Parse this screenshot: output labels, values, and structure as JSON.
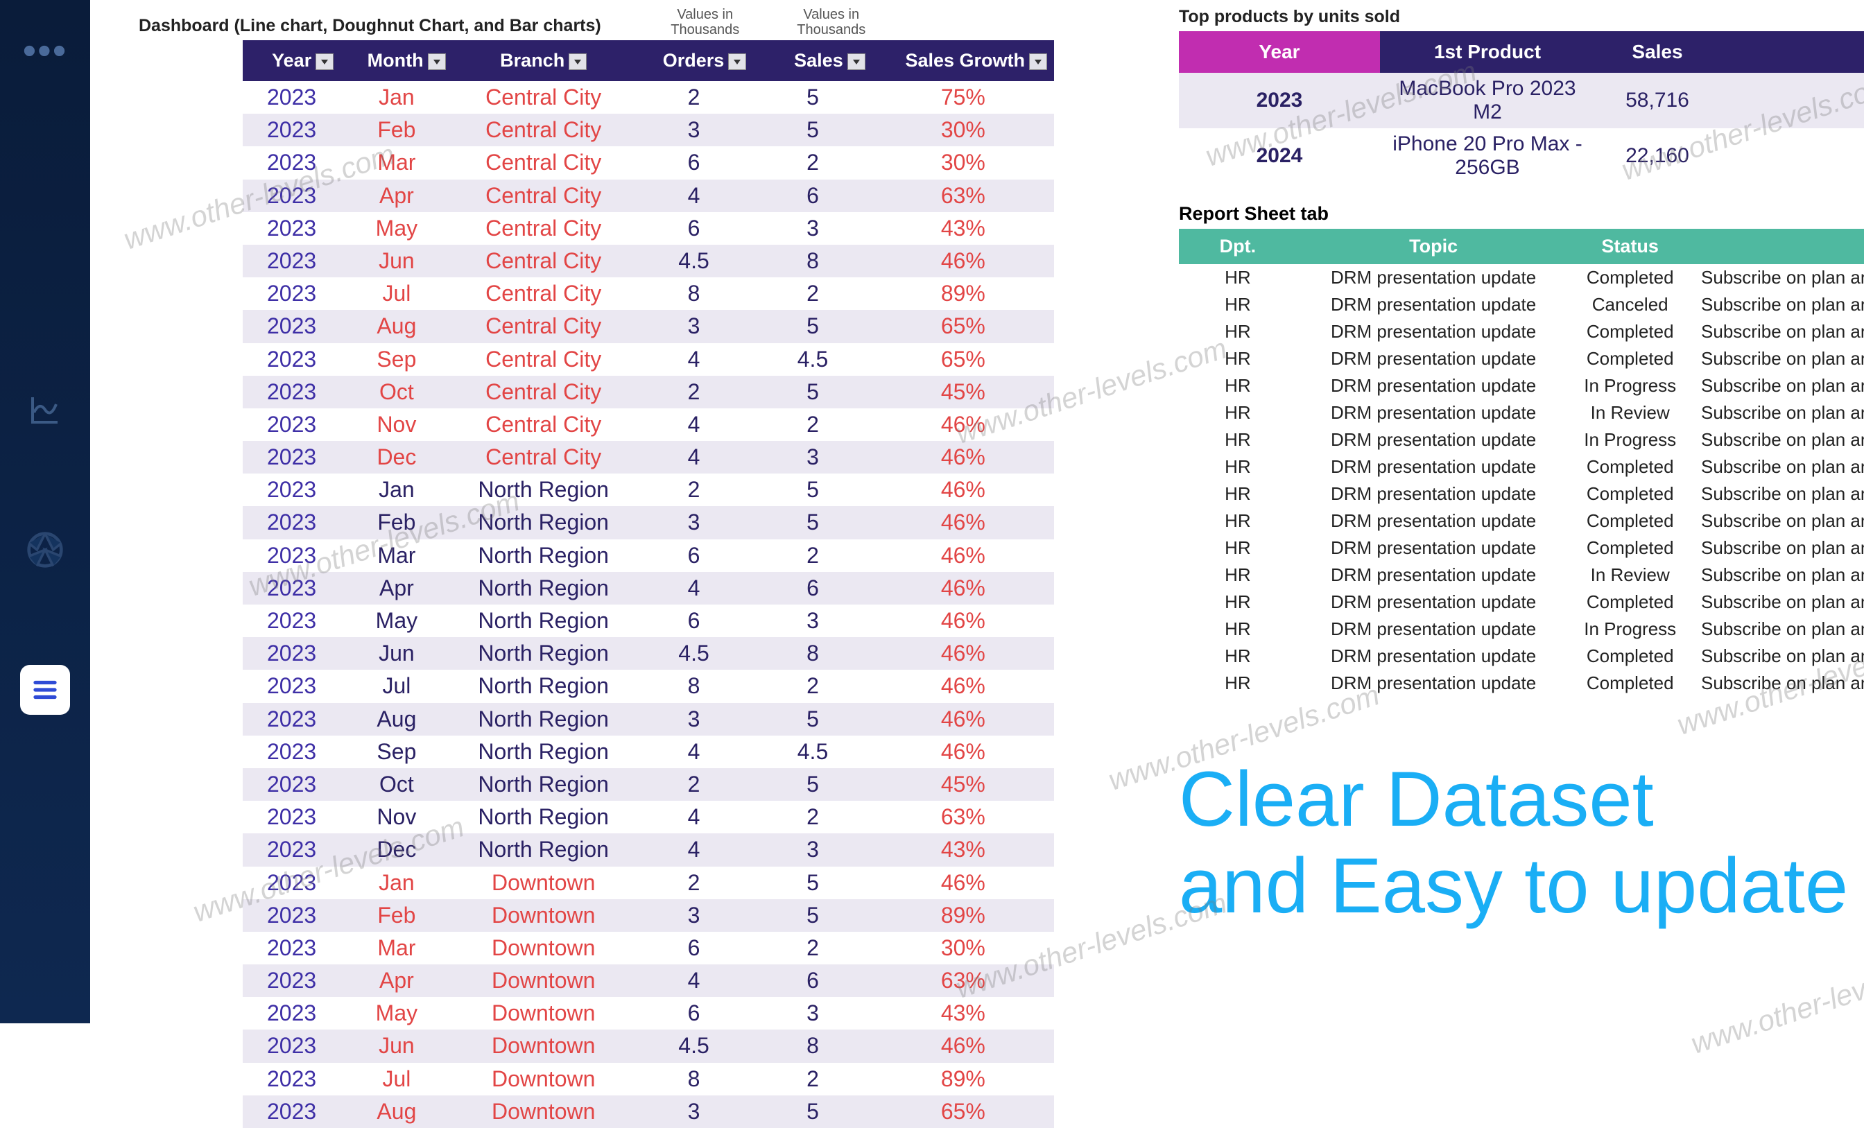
{
  "sidebar": {
    "dots": "•••"
  },
  "dashboard": {
    "title": "Dashboard (Line chart, Doughnut Chart, and Bar charts)",
    "header_note1": "Values in Thousands",
    "header_note2": "Values in Thousands",
    "columns": [
      "Year",
      "Month",
      "Branch",
      "Orders",
      "Sales",
      "Sales Growth"
    ],
    "rows": [
      {
        "year": "2023",
        "month": "Jan",
        "branch": "Central City",
        "orders": "2",
        "sales": "5",
        "growth": "75%",
        "cls": "cc"
      },
      {
        "year": "2023",
        "month": "Feb",
        "branch": "Central City",
        "orders": "3",
        "sales": "5",
        "growth": "30%",
        "cls": "cc"
      },
      {
        "year": "2023",
        "month": "Mar",
        "branch": "Central City",
        "orders": "6",
        "sales": "2",
        "growth": "30%",
        "cls": "cc"
      },
      {
        "year": "2023",
        "month": "Apr",
        "branch": "Central City",
        "orders": "4",
        "sales": "6",
        "growth": "63%",
        "cls": "cc"
      },
      {
        "year": "2023",
        "month": "May",
        "branch": "Central City",
        "orders": "6",
        "sales": "3",
        "growth": "43%",
        "cls": "cc"
      },
      {
        "year": "2023",
        "month": "Jun",
        "branch": "Central City",
        "orders": "4.5",
        "sales": "8",
        "growth": "46%",
        "cls": "cc"
      },
      {
        "year": "2023",
        "month": "Jul",
        "branch": "Central City",
        "orders": "8",
        "sales": "2",
        "growth": "89%",
        "cls": "cc"
      },
      {
        "year": "2023",
        "month": "Aug",
        "branch": "Central City",
        "orders": "3",
        "sales": "5",
        "growth": "65%",
        "cls": "cc"
      },
      {
        "year": "2023",
        "month": "Sep",
        "branch": "Central City",
        "orders": "4",
        "sales": "4.5",
        "growth": "65%",
        "cls": "cc"
      },
      {
        "year": "2023",
        "month": "Oct",
        "branch": "Central City",
        "orders": "2",
        "sales": "5",
        "growth": "45%",
        "cls": "cc"
      },
      {
        "year": "2023",
        "month": "Nov",
        "branch": "Central City",
        "orders": "4",
        "sales": "2",
        "growth": "46%",
        "cls": "cc"
      },
      {
        "year": "2023",
        "month": "Dec",
        "branch": "Central City",
        "orders": "4",
        "sales": "3",
        "growth": "46%",
        "cls": "cc"
      },
      {
        "year": "2023",
        "month": "Jan",
        "branch": "North Region",
        "orders": "2",
        "sales": "5",
        "growth": "46%",
        "cls": "nr"
      },
      {
        "year": "2023",
        "month": "Feb",
        "branch": "North Region",
        "orders": "3",
        "sales": "5",
        "growth": "46%",
        "cls": "nr"
      },
      {
        "year": "2023",
        "month": "Mar",
        "branch": "North Region",
        "orders": "6",
        "sales": "2",
        "growth": "46%",
        "cls": "nr"
      },
      {
        "year": "2023",
        "month": "Apr",
        "branch": "North Region",
        "orders": "4",
        "sales": "6",
        "growth": "46%",
        "cls": "nr"
      },
      {
        "year": "2023",
        "month": "May",
        "branch": "North Region",
        "orders": "6",
        "sales": "3",
        "growth": "46%",
        "cls": "nr"
      },
      {
        "year": "2023",
        "month": "Jun",
        "branch": "North Region",
        "orders": "4.5",
        "sales": "8",
        "growth": "46%",
        "cls": "nr"
      },
      {
        "year": "2023",
        "month": "Jul",
        "branch": "North Region",
        "orders": "8",
        "sales": "2",
        "growth": "46%",
        "cls": "nr"
      },
      {
        "year": "2023",
        "month": "Aug",
        "branch": "North Region",
        "orders": "3",
        "sales": "5",
        "growth": "46%",
        "cls": "nr"
      },
      {
        "year": "2023",
        "month": "Sep",
        "branch": "North Region",
        "orders": "4",
        "sales": "4.5",
        "growth": "46%",
        "cls": "nr"
      },
      {
        "year": "2023",
        "month": "Oct",
        "branch": "North Region",
        "orders": "2",
        "sales": "5",
        "growth": "45%",
        "cls": "nr"
      },
      {
        "year": "2023",
        "month": "Nov",
        "branch": "North Region",
        "orders": "4",
        "sales": "2",
        "growth": "63%",
        "cls": "nr"
      },
      {
        "year": "2023",
        "month": "Dec",
        "branch": "North Region",
        "orders": "4",
        "sales": "3",
        "growth": "43%",
        "cls": "nr"
      },
      {
        "year": "2023",
        "month": "Jan",
        "branch": "Downtown",
        "orders": "2",
        "sales": "5",
        "growth": "46%",
        "cls": "dt"
      },
      {
        "year": "2023",
        "month": "Feb",
        "branch": "Downtown",
        "orders": "3",
        "sales": "5",
        "growth": "89%",
        "cls": "dt"
      },
      {
        "year": "2023",
        "month": "Mar",
        "branch": "Downtown",
        "orders": "6",
        "sales": "2",
        "growth": "30%",
        "cls": "dt"
      },
      {
        "year": "2023",
        "month": "Apr",
        "branch": "Downtown",
        "orders": "4",
        "sales": "6",
        "growth": "63%",
        "cls": "dt"
      },
      {
        "year": "2023",
        "month": "May",
        "branch": "Downtown",
        "orders": "6",
        "sales": "3",
        "growth": "43%",
        "cls": "dt"
      },
      {
        "year": "2023",
        "month": "Jun",
        "branch": "Downtown",
        "orders": "4.5",
        "sales": "8",
        "growth": "46%",
        "cls": "dt"
      },
      {
        "year": "2023",
        "month": "Jul",
        "branch": "Downtown",
        "orders": "8",
        "sales": "2",
        "growth": "89%",
        "cls": "dt"
      },
      {
        "year": "2023",
        "month": "Aug",
        "branch": "Downtown",
        "orders": "3",
        "sales": "5",
        "growth": "65%",
        "cls": "dt"
      }
    ]
  },
  "top_products": {
    "title": "Top products by units sold",
    "columns": [
      "Year",
      "1st Product",
      "Sales",
      ""
    ],
    "rows": [
      {
        "year": "2023",
        "product": "MacBook Pro 2023 M2",
        "sales": "58,716"
      },
      {
        "year": "2024",
        "product": "iPhone 20 Pro Max - 256GB",
        "sales": "22,160"
      }
    ]
  },
  "report": {
    "title": "Report Sheet tab",
    "columns": [
      "Dpt.",
      "Topic",
      "Status",
      ""
    ],
    "note": "Subscribe on plan and v",
    "rows": [
      {
        "dpt": "HR",
        "topic": "DRM presentation update",
        "status": "Completed"
      },
      {
        "dpt": "HR",
        "topic": "DRM presentation update",
        "status": "Canceled"
      },
      {
        "dpt": "HR",
        "topic": "DRM presentation update",
        "status": "Completed"
      },
      {
        "dpt": "HR",
        "topic": "DRM presentation update",
        "status": "Completed"
      },
      {
        "dpt": "HR",
        "topic": "DRM presentation update",
        "status": "In Progress"
      },
      {
        "dpt": "HR",
        "topic": "DRM presentation update",
        "status": "In Review"
      },
      {
        "dpt": "HR",
        "topic": "DRM presentation update",
        "status": "In Progress"
      },
      {
        "dpt": "HR",
        "topic": "DRM presentation update",
        "status": "Completed"
      },
      {
        "dpt": "HR",
        "topic": "DRM presentation update",
        "status": "Completed"
      },
      {
        "dpt": "HR",
        "topic": "DRM presentation update",
        "status": "Completed"
      },
      {
        "dpt": "HR",
        "topic": "DRM presentation update",
        "status": "Completed"
      },
      {
        "dpt": "HR",
        "topic": "DRM presentation update",
        "status": "In Review"
      },
      {
        "dpt": "HR",
        "topic": "DRM presentation update",
        "status": "Completed"
      },
      {
        "dpt": "HR",
        "topic": "DRM presentation update",
        "status": "In Progress"
      },
      {
        "dpt": "HR",
        "topic": "DRM presentation update",
        "status": "Completed"
      },
      {
        "dpt": "HR",
        "topic": "DRM presentation update",
        "status": "Completed"
      }
    ]
  },
  "promo": {
    "line1": "Clear Dataset",
    "line2": "and Easy to update"
  },
  "watermark": "www.other-levels.com"
}
